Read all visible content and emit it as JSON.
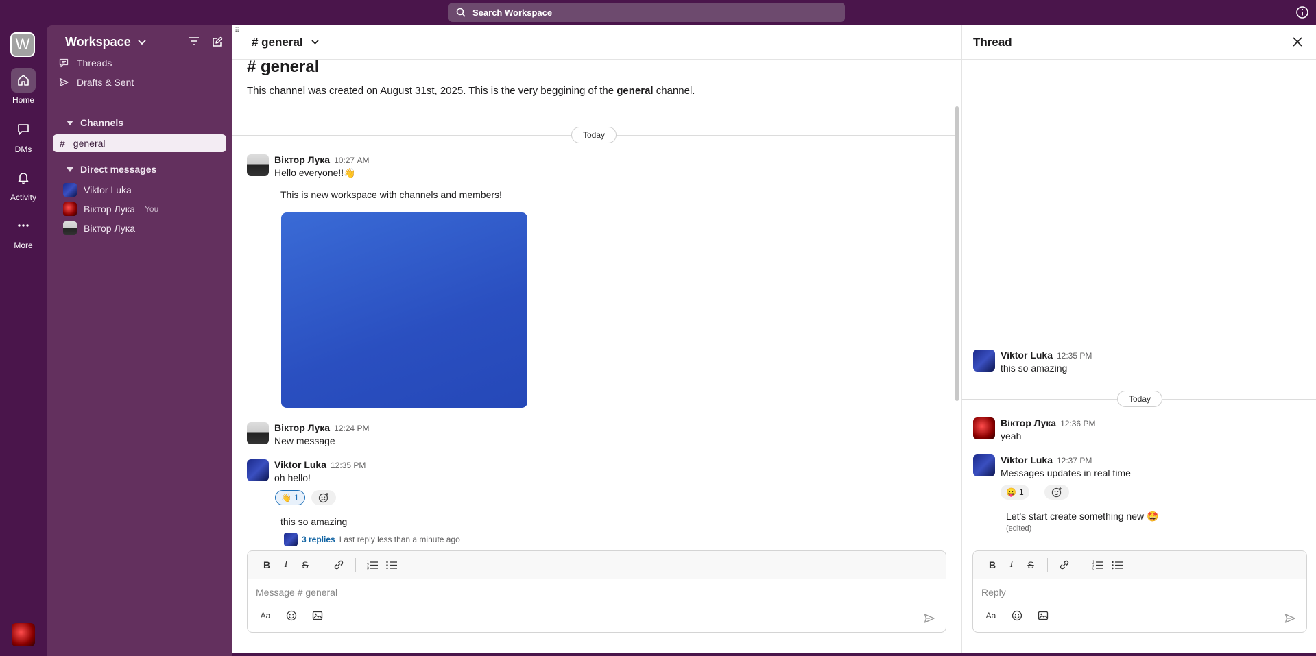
{
  "search": {
    "placeholder": "Search Workspace"
  },
  "rail": {
    "workspace_initial": "W",
    "items": [
      {
        "label": "Home",
        "icon": "home-icon"
      },
      {
        "label": "DMs",
        "icon": "message-icon"
      },
      {
        "label": "Activity",
        "icon": "bell-icon"
      },
      {
        "label": "More",
        "icon": "more-icon"
      }
    ]
  },
  "sidebar": {
    "workspace_name": "Workspace",
    "links": [
      {
        "label": "Threads",
        "icon": "threads-icon"
      },
      {
        "label": "Drafts & Sent",
        "icon": "send-icon"
      }
    ],
    "channels_header": "Channels",
    "channels": [
      {
        "hash": "#",
        "name": "general"
      }
    ],
    "dms_header": "Direct messages",
    "dms": [
      {
        "name": "Viktor Luka",
        "tag": ""
      },
      {
        "name": "Віктор Лука",
        "tag": "You"
      },
      {
        "name": "Віктор Лука",
        "tag": ""
      }
    ]
  },
  "main": {
    "header_title": "# general",
    "intro_title": "# general",
    "intro_before": "This channel was created on August 31st, 2025. This is the very beggining of the ",
    "intro_bold": "general",
    "intro_after": " channel.",
    "day_label": "Today",
    "messages": [
      {
        "name": "Віктор Лука",
        "time": "10:27 AM",
        "text": "Hello everyone!!👋",
        "extra": "This is new workspace with channels and members!"
      },
      {
        "name": "Віктор Лука",
        "time": "12:24 PM",
        "text": "New message"
      },
      {
        "name": "Viktor Luka",
        "time": "12:35 PM",
        "text": "oh hello!",
        "reaction_emoji": "👋",
        "reaction_count": "1",
        "extra": "this so amazing",
        "replies_count": "3 replies",
        "replies_last": "Last reply less than a minute ago"
      }
    ],
    "composer_placeholder": "Message # general",
    "toolbar": {
      "bold": "B",
      "italic": "I",
      "strike": "S",
      "format": "Aa"
    }
  },
  "thread": {
    "title": "Thread",
    "day_label": "Today",
    "messages": [
      {
        "name": "Viktor Luka",
        "time": "12:35 PM",
        "text": "this so amazing"
      },
      {
        "name": "Віктор Лука",
        "time": "12:36 PM",
        "text": "yeah"
      },
      {
        "name": "Viktor Luka",
        "time": "12:37 PM",
        "text": "Messages updates in real time",
        "reaction_emoji": "😛",
        "reaction_count": "1",
        "extra": "Let's start create something new 🤩",
        "edited": "(edited)"
      }
    ],
    "composer_placeholder": "Reply"
  },
  "colors": {
    "aubergine": "#4a154b",
    "sidebar": "#63305e",
    "link_blue": "#1264a3"
  }
}
